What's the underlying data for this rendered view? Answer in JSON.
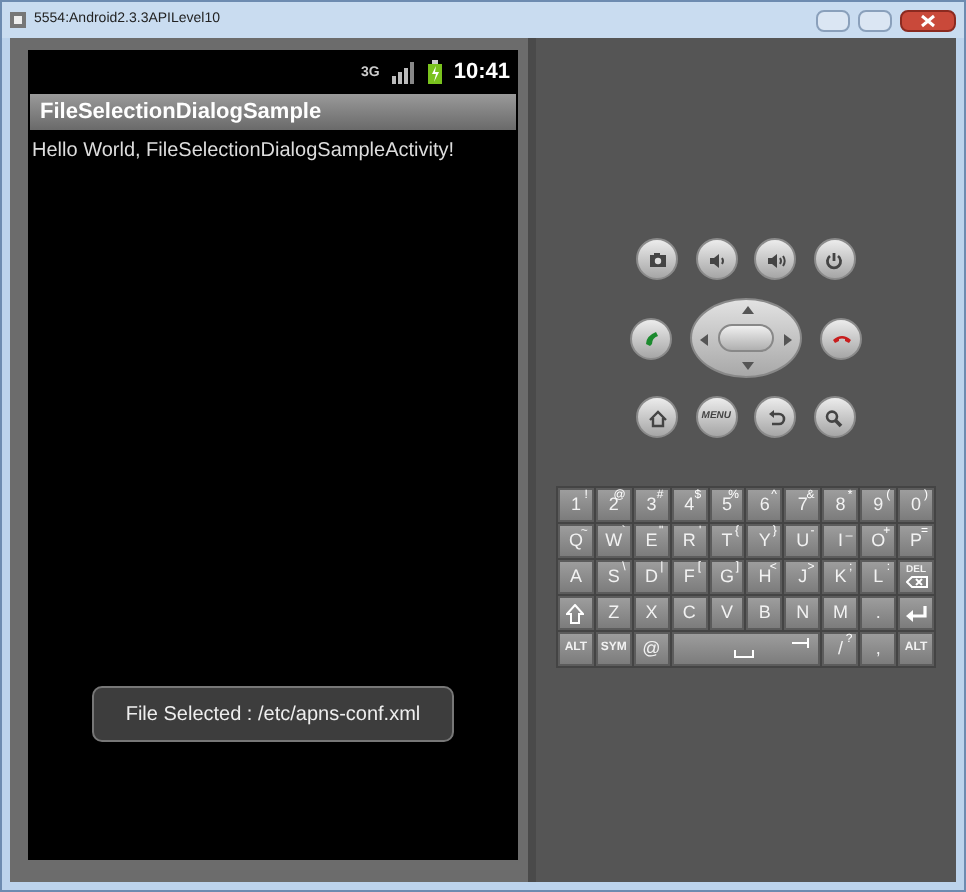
{
  "window": {
    "title": "5554:Android2.3.3APILevel10"
  },
  "status_bar": {
    "network": "3G",
    "time": "10:41"
  },
  "app": {
    "title": "FileSelectionDialogSample",
    "message": "Hello World, FileSelectionDialogSampleActivity!"
  },
  "toast": {
    "text": "File Selected : /etc/apns-conf.xml"
  },
  "hardware_buttons": [
    [
      {
        "kind": "camera"
      },
      {
        "kind": "volume-down"
      },
      {
        "kind": "volume-up"
      },
      {
        "kind": "power"
      }
    ],
    [
      {
        "kind": "call"
      },
      {
        "kind": "dpad"
      },
      {
        "kind": "end-call"
      }
    ],
    [
      {
        "kind": "home"
      },
      {
        "kind": "menu",
        "label": "MENU"
      },
      {
        "kind": "back"
      },
      {
        "kind": "search"
      }
    ]
  ],
  "keyboard": {
    "rows": [
      [
        {
          "kind": "char",
          "label": "1",
          "alt": "!"
        },
        {
          "kind": "char",
          "label": "2",
          "alt": "@"
        },
        {
          "kind": "char",
          "label": "3",
          "alt": "#"
        },
        {
          "kind": "char",
          "label": "4",
          "alt": "$"
        },
        {
          "kind": "char",
          "label": "5",
          "alt": "%"
        },
        {
          "kind": "char",
          "label": "6",
          "alt": "^"
        },
        {
          "kind": "char",
          "label": "7",
          "alt": "&"
        },
        {
          "kind": "char",
          "label": "8",
          "alt": "*"
        },
        {
          "kind": "char",
          "label": "9",
          "alt": "("
        },
        {
          "kind": "char",
          "label": "0",
          "alt": ")"
        }
      ],
      [
        {
          "kind": "char",
          "label": "Q",
          "alt": "~"
        },
        {
          "kind": "char",
          "label": "W",
          "alt": "`"
        },
        {
          "kind": "char",
          "label": "E",
          "alt": "\""
        },
        {
          "kind": "char",
          "label": "R",
          "alt": "'"
        },
        {
          "kind": "char",
          "label": "T",
          "alt": "{"
        },
        {
          "kind": "char",
          "label": "Y",
          "alt": "}"
        },
        {
          "kind": "char",
          "label": "U",
          "alt": "-"
        },
        {
          "kind": "char",
          "label": "I",
          "alt": "_"
        },
        {
          "kind": "char",
          "label": "O",
          "alt": "+"
        },
        {
          "kind": "char",
          "label": "P",
          "alt": "="
        }
      ],
      [
        {
          "kind": "char",
          "label": "A"
        },
        {
          "kind": "char",
          "label": "S",
          "alt": "\\"
        },
        {
          "kind": "char",
          "label": "D",
          "alt": "|"
        },
        {
          "kind": "char",
          "label": "F",
          "alt": "["
        },
        {
          "kind": "char",
          "label": "G",
          "alt": "]"
        },
        {
          "kind": "char",
          "label": "H",
          "alt": "<"
        },
        {
          "kind": "char",
          "label": "J",
          "alt": ">"
        },
        {
          "kind": "char",
          "label": "K",
          "alt": ";"
        },
        {
          "kind": "char",
          "label": "L",
          "alt": ":"
        },
        {
          "kind": "delete",
          "label": "DEL"
        }
      ],
      [
        {
          "kind": "shift"
        },
        {
          "kind": "char",
          "label": "Z"
        },
        {
          "kind": "char",
          "label": "X"
        },
        {
          "kind": "char",
          "label": "C"
        },
        {
          "kind": "char",
          "label": "V"
        },
        {
          "kind": "char",
          "label": "B"
        },
        {
          "kind": "char",
          "label": "N"
        },
        {
          "kind": "char",
          "label": "M"
        },
        {
          "kind": "char",
          "label": "."
        },
        {
          "kind": "enter"
        }
      ]
    ],
    "bottom_row": [
      {
        "kind": "char",
        "label": "ALT"
      },
      {
        "kind": "char",
        "label": "SYM"
      },
      {
        "kind": "char",
        "label": "@"
      },
      {
        "kind": "space"
      },
      {
        "kind": "char",
        "label": "/",
        "alt": "?"
      },
      {
        "kind": "char",
        "label": ","
      },
      {
        "kind": "char",
        "label": "ALT"
      }
    ]
  }
}
